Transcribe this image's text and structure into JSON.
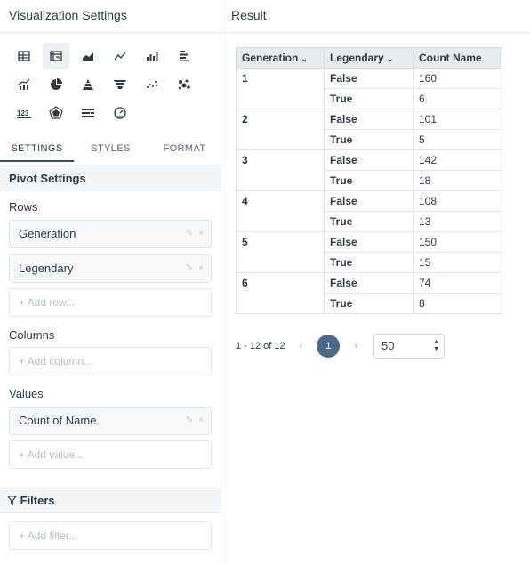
{
  "left_panel": {
    "title": "Visualization Settings",
    "viz_icons": [
      "table-icon",
      "pivot-table-icon",
      "area-chart-icon",
      "line-chart-icon",
      "bar-chart-icon",
      "horizontal-bar-chart-icon",
      "combo-chart-icon",
      "pie-chart-icon",
      "pyramid-icon",
      "funnel-icon",
      "scatter-icon",
      "bubble-icon",
      "number-icon",
      "radar-icon",
      "bullet-chart-icon",
      "gauge-icon"
    ],
    "tabs": [
      "SETTINGS",
      "STYLES",
      "FORMAT"
    ],
    "pivot_settings": "Pivot Settings",
    "rows_label": "Rows",
    "rows": [
      "Generation",
      "Legendary"
    ],
    "add_row": "+ Add row...",
    "columns_label": "Columns",
    "add_column": "+ Add column...",
    "values_label": "Values",
    "values": [
      "Count of Name"
    ],
    "add_value": "+ Add value...",
    "filters_title": "Filters",
    "add_filter": "+ Add filter..."
  },
  "result_panel": {
    "title": "Result",
    "headers": [
      "Generation",
      "Legendary",
      "Count Name"
    ],
    "groups": [
      {
        "generation": "1",
        "rows": [
          {
            "legendary": "False",
            "count": "160"
          },
          {
            "legendary": "True",
            "count": "6"
          }
        ]
      },
      {
        "generation": "2",
        "rows": [
          {
            "legendary": "False",
            "count": "101"
          },
          {
            "legendary": "True",
            "count": "5"
          }
        ]
      },
      {
        "generation": "3",
        "rows": [
          {
            "legendary": "False",
            "count": "142"
          },
          {
            "legendary": "True",
            "count": "18"
          }
        ]
      },
      {
        "generation": "4",
        "rows": [
          {
            "legendary": "False",
            "count": "108"
          },
          {
            "legendary": "True",
            "count": "13"
          }
        ]
      },
      {
        "generation": "5",
        "rows": [
          {
            "legendary": "False",
            "count": "150"
          },
          {
            "legendary": "True",
            "count": "15"
          }
        ]
      },
      {
        "generation": "6",
        "rows": [
          {
            "legendary": "False",
            "count": "74"
          },
          {
            "legendary": "True",
            "count": "8"
          }
        ]
      }
    ],
    "pagination": {
      "range": "1 - 12 of 12",
      "prev": "‹",
      "page": "1",
      "next": "›",
      "page_size": "50"
    }
  },
  "colors": {
    "page_active": "#4a6984",
    "header_bg": "#e9ecef"
  }
}
